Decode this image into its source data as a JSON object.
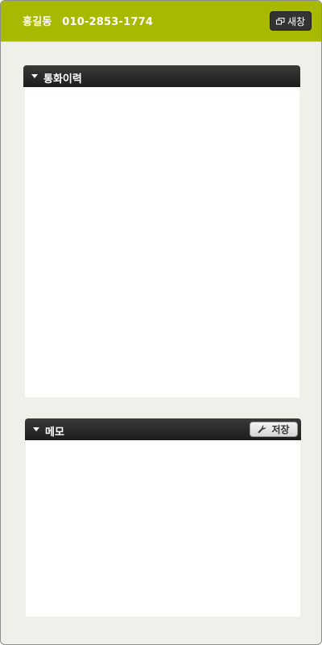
{
  "header": {
    "contact_name": "홍길동",
    "contact_phone": "010-2853-1774",
    "new_window_label": "새창",
    "new_window_icon": "new-window-icon",
    "background_color": "#a9b800"
  },
  "call_history": {
    "title": "통화이력",
    "toggle_icon": "triangle-down-icon"
  },
  "memo": {
    "title": "메모",
    "toggle_icon": "triangle-down-icon",
    "save_label": "저장",
    "save_icon": "wrench-icon"
  }
}
